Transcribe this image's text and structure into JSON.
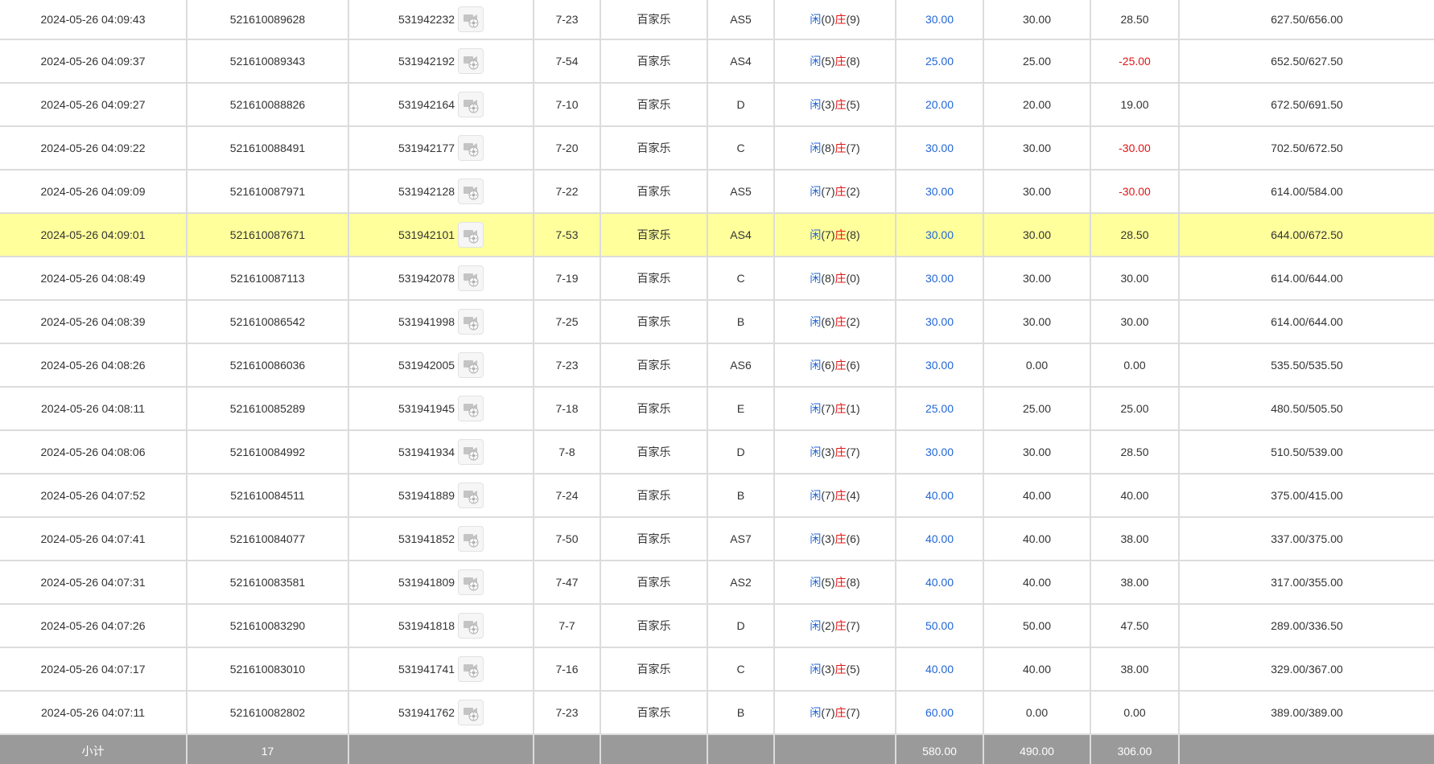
{
  "video_icon": "video-replay-icon",
  "colors": {
    "player": "#2266d6",
    "banker": "#e01515",
    "negative": "#e01515",
    "highlight_row": "#ffff9c",
    "subtotal_bg": "#9a9a9a",
    "grid": "#dcdcdc"
  },
  "labels": {
    "player": "闲",
    "banker": "庄"
  },
  "rows": [
    {
      "time": "2024-05-26 04:09:43",
      "bet_id": "521610089628",
      "game_id": "531942232",
      "round": "7-23",
      "game": "百家乐",
      "table": "AS5",
      "player_pts": "(0)",
      "banker_pts": "(9)",
      "bet": "30.00",
      "valid": "30.00",
      "win": "28.50",
      "win_negative": false,
      "balance": "627.50/656.00",
      "highlighted": false
    },
    {
      "time": "2024-05-26 04:09:37",
      "bet_id": "521610089343",
      "game_id": "531942192",
      "round": "7-54",
      "game": "百家乐",
      "table": "AS4",
      "player_pts": "(5)",
      "banker_pts": "(8)",
      "bet": "25.00",
      "valid": "25.00",
      "win": "-25.00",
      "win_negative": true,
      "balance": "652.50/627.50",
      "highlighted": false
    },
    {
      "time": "2024-05-26 04:09:27",
      "bet_id": "521610088826",
      "game_id": "531942164",
      "round": "7-10",
      "game": "百家乐",
      "table": "D",
      "player_pts": "(3)",
      "banker_pts": "(5)",
      "bet": "20.00",
      "valid": "20.00",
      "win": "19.00",
      "win_negative": false,
      "balance": "672.50/691.50",
      "highlighted": false
    },
    {
      "time": "2024-05-26 04:09:22",
      "bet_id": "521610088491",
      "game_id": "531942177",
      "round": "7-20",
      "game": "百家乐",
      "table": "C",
      "player_pts": "(8)",
      "banker_pts": "(7)",
      "bet": "30.00",
      "valid": "30.00",
      "win": "-30.00",
      "win_negative": true,
      "balance": "702.50/672.50",
      "highlighted": false
    },
    {
      "time": "2024-05-26 04:09:09",
      "bet_id": "521610087971",
      "game_id": "531942128",
      "round": "7-22",
      "game": "百家乐",
      "table": "AS5",
      "player_pts": "(7)",
      "banker_pts": "(2)",
      "bet": "30.00",
      "valid": "30.00",
      "win": "-30.00",
      "win_negative": true,
      "balance": "614.00/584.00",
      "highlighted": false
    },
    {
      "time": "2024-05-26 04:09:01",
      "bet_id": "521610087671",
      "game_id": "531942101",
      "round": "7-53",
      "game": "百家乐",
      "table": "AS4",
      "player_pts": "(7)",
      "banker_pts": "(8)",
      "bet": "30.00",
      "valid": "30.00",
      "win": "28.50",
      "win_negative": false,
      "balance": "644.00/672.50",
      "highlighted": true
    },
    {
      "time": "2024-05-26 04:08:49",
      "bet_id": "521610087113",
      "game_id": "531942078",
      "round": "7-19",
      "game": "百家乐",
      "table": "C",
      "player_pts": "(8)",
      "banker_pts": "(0)",
      "bet": "30.00",
      "valid": "30.00",
      "win": "30.00",
      "win_negative": false,
      "balance": "614.00/644.00",
      "highlighted": false
    },
    {
      "time": "2024-05-26 04:08:39",
      "bet_id": "521610086542",
      "game_id": "531941998",
      "round": "7-25",
      "game": "百家乐",
      "table": "B",
      "player_pts": "(6)",
      "banker_pts": "(2)",
      "bet": "30.00",
      "valid": "30.00",
      "win": "30.00",
      "win_negative": false,
      "balance": "614.00/644.00",
      "highlighted": false
    },
    {
      "time": "2024-05-26 04:08:26",
      "bet_id": "521610086036",
      "game_id": "531942005",
      "round": "7-23",
      "game": "百家乐",
      "table": "AS6",
      "player_pts": "(6)",
      "banker_pts": "(6)",
      "bet": "30.00",
      "valid": "0.00",
      "win": "0.00",
      "win_negative": false,
      "balance": "535.50/535.50",
      "highlighted": false
    },
    {
      "time": "2024-05-26 04:08:11",
      "bet_id": "521610085289",
      "game_id": "531941945",
      "round": "7-18",
      "game": "百家乐",
      "table": "E",
      "player_pts": "(7)",
      "banker_pts": "(1)",
      "bet": "25.00",
      "valid": "25.00",
      "win": "25.00",
      "win_negative": false,
      "balance": "480.50/505.50",
      "highlighted": false
    },
    {
      "time": "2024-05-26 04:08:06",
      "bet_id": "521610084992",
      "game_id": "531941934",
      "round": "7-8",
      "game": "百家乐",
      "table": "D",
      "player_pts": "(3)",
      "banker_pts": "(7)",
      "bet": "30.00",
      "valid": "30.00",
      "win": "28.50",
      "win_negative": false,
      "balance": "510.50/539.00",
      "highlighted": false
    },
    {
      "time": "2024-05-26 04:07:52",
      "bet_id": "521610084511",
      "game_id": "531941889",
      "round": "7-24",
      "game": "百家乐",
      "table": "B",
      "player_pts": "(7)",
      "banker_pts": "(4)",
      "bet": "40.00",
      "valid": "40.00",
      "win": "40.00",
      "win_negative": false,
      "balance": "375.00/415.00",
      "highlighted": false
    },
    {
      "time": "2024-05-26 04:07:41",
      "bet_id": "521610084077",
      "game_id": "531941852",
      "round": "7-50",
      "game": "百家乐",
      "table": "AS7",
      "player_pts": "(3)",
      "banker_pts": "(6)",
      "bet": "40.00",
      "valid": "40.00",
      "win": "38.00",
      "win_negative": false,
      "balance": "337.00/375.00",
      "highlighted": false
    },
    {
      "time": "2024-05-26 04:07:31",
      "bet_id": "521610083581",
      "game_id": "531941809",
      "round": "7-47",
      "game": "百家乐",
      "table": "AS2",
      "player_pts": "(5)",
      "banker_pts": "(8)",
      "bet": "40.00",
      "valid": "40.00",
      "win": "38.00",
      "win_negative": false,
      "balance": "317.00/355.00",
      "highlighted": false
    },
    {
      "time": "2024-05-26 04:07:26",
      "bet_id": "521610083290",
      "game_id": "531941818",
      "round": "7-7",
      "game": "百家乐",
      "table": "D",
      "player_pts": "(2)",
      "banker_pts": "(7)",
      "bet": "50.00",
      "valid": "50.00",
      "win": "47.50",
      "win_negative": false,
      "balance": "289.00/336.50",
      "highlighted": false
    },
    {
      "time": "2024-05-26 04:07:17",
      "bet_id": "521610083010",
      "game_id": "531941741",
      "round": "7-16",
      "game": "百家乐",
      "table": "C",
      "player_pts": "(3)",
      "banker_pts": "(5)",
      "bet": "40.00",
      "valid": "40.00",
      "win": "38.00",
      "win_negative": false,
      "balance": "329.00/367.00",
      "highlighted": false
    },
    {
      "time": "2024-05-26 04:07:11",
      "bet_id": "521610082802",
      "game_id": "531941762",
      "round": "7-23",
      "game": "百家乐",
      "table": "B",
      "player_pts": "(7)",
      "banker_pts": "(7)",
      "bet": "60.00",
      "valid": "0.00",
      "win": "0.00",
      "win_negative": false,
      "balance": "389.00/389.00",
      "highlighted": false
    }
  ],
  "subtotal": {
    "label": "小计",
    "count": "17",
    "bet": "580.00",
    "valid": "490.00",
    "win": "306.00"
  }
}
